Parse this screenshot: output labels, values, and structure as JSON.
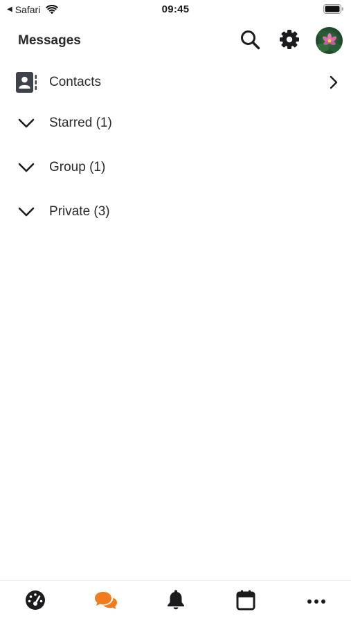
{
  "status_bar": {
    "back_app": "Safari",
    "time": "09:45",
    "icons": [
      "back-arrow-icon",
      "wifi-icon",
      "battery-icon"
    ]
  },
  "header": {
    "title": "Messages",
    "icons": [
      "search-icon",
      "gear-icon",
      "avatar"
    ]
  },
  "list": {
    "contacts": {
      "label": "Contacts",
      "icon": "contacts-book-icon",
      "chevron": "chevron-right-icon"
    },
    "groups": [
      {
        "label": "Starred (1)",
        "icon": "chevron-down-icon"
      },
      {
        "label": "Group (1)",
        "icon": "chevron-down-icon"
      },
      {
        "label": "Private (3)",
        "icon": "chevron-down-icon"
      }
    ]
  },
  "tab_bar": {
    "tabs": [
      {
        "name": "dashboard",
        "icon": "dashboard-gauge-icon",
        "active": false
      },
      {
        "name": "messages",
        "icon": "chat-bubbles-icon",
        "active": true
      },
      {
        "name": "notifications",
        "icon": "bell-icon",
        "active": false
      },
      {
        "name": "calendar",
        "icon": "calendar-icon",
        "active": false
      },
      {
        "name": "more",
        "icon": "more-dots-icon",
        "active": false
      }
    ]
  },
  "colors": {
    "accent": "#f07c1f",
    "icon_dark": "#1c1c1e",
    "text": "#2a2a2c",
    "contacts_icon_bg": "#3f4349"
  }
}
